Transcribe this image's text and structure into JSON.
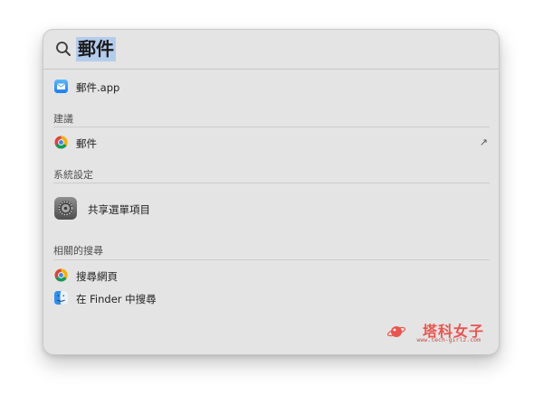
{
  "search": {
    "query": "郵件"
  },
  "top_hit": {
    "label": "郵件.app",
    "icon": "mail-app-icon"
  },
  "sections": {
    "suggestions": {
      "header": "建議",
      "item_label": "郵件",
      "item_icon": "chrome-icon",
      "action_icon": "north-east-arrow-icon",
      "action_glyph": "↗"
    },
    "system_settings": {
      "header": "系統設定",
      "item_label": "共享選單項目",
      "item_icon": "settings-gear-icon"
    },
    "related_searches": {
      "header": "相關的搜尋",
      "items": [
        {
          "label": "搜尋網頁",
          "icon": "chrome-icon"
        },
        {
          "label": "在 Finder 中搜尋",
          "icon": "finder-icon"
        }
      ]
    }
  },
  "watermark": {
    "title": "塔科女子",
    "subtitle": "www.tech-girlz.com"
  },
  "colors": {
    "panel_background": "#e4e4e4",
    "selection_highlight": "#b4ccec",
    "watermark_red": "#e9554e"
  }
}
